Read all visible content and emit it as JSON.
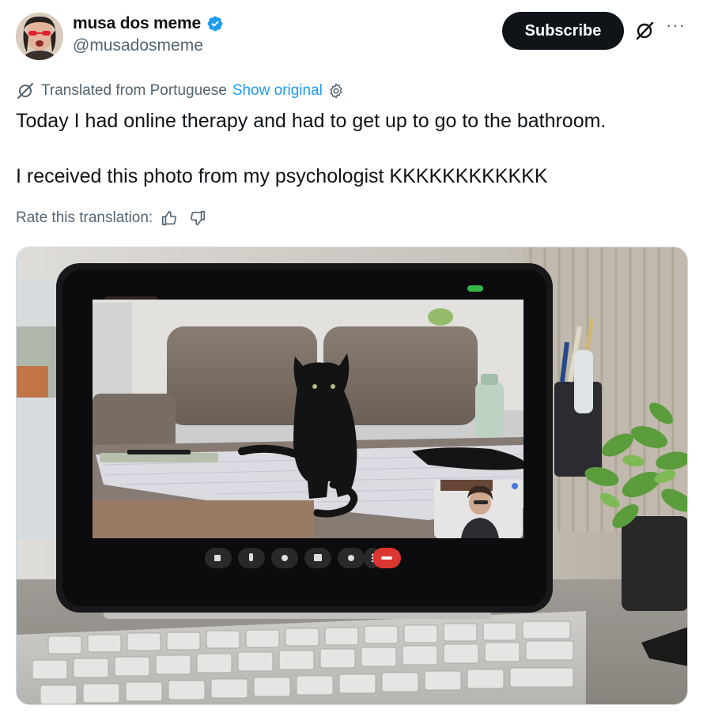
{
  "author": {
    "display_name": "musa dos meme",
    "handle": "@musadosmeme"
  },
  "actions": {
    "subscribe_label": "Subscribe"
  },
  "translation": {
    "translated_label": "Translated from Portuguese",
    "show_original_label": "Show original",
    "rate_label": "Rate this translation:"
  },
  "tweet": {
    "line1": "Today I had online therapy and had to get up to go to the bathroom.",
    "line2": "I received this photo from my psychologist KKKKKKKKKKKK"
  },
  "icons": {
    "verified": "verified-badge-icon",
    "grok": "grok-icon",
    "more": "more-icon",
    "translate": "translate-icon",
    "settings": "gear-icon",
    "thumbs_up": "thumbs-up-icon",
    "thumbs_down": "thumbs-down-icon",
    "end_call": "end-call-icon"
  },
  "colors": {
    "link_blue": "#1d9bf0",
    "text_primary": "#0f1419",
    "text_secondary": "#536471",
    "button_dark": "#0f1419",
    "end_call_red": "#e53935"
  }
}
